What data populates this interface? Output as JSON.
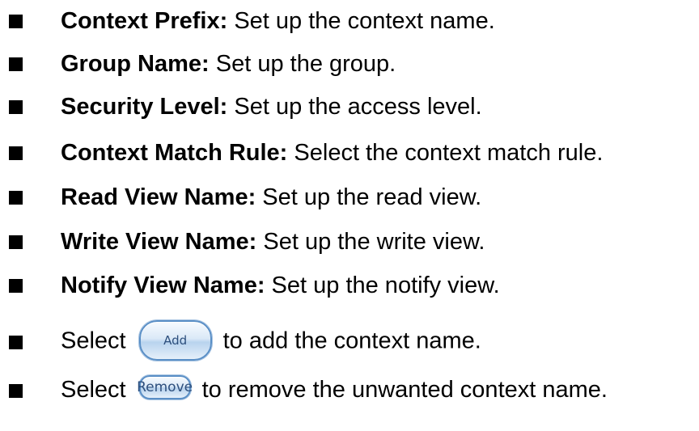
{
  "items": [
    {
      "term": "Context Prefix:",
      "desc": " Set up the context name."
    },
    {
      "term": "Group Name:",
      "desc": " Set up the group."
    },
    {
      "term": "Security Level:",
      "desc": " Set up the access level."
    },
    {
      "term": "Context Match Rule:",
      "desc": " Select the context match rule."
    },
    {
      "term": "Read View Name:",
      "desc": " Set up the read view."
    },
    {
      "term": "Write View Name:",
      "desc": " Set up the write view."
    },
    {
      "term": "Notify View Name:",
      "desc": " Set up the notify view."
    }
  ],
  "add_line": {
    "prefix": "Select",
    "button_label": "Add",
    "suffix": "to add the context name."
  },
  "remove_line": {
    "prefix": "Select",
    "button_label": "Remove",
    "suffix": "to remove the unwanted context name."
  }
}
